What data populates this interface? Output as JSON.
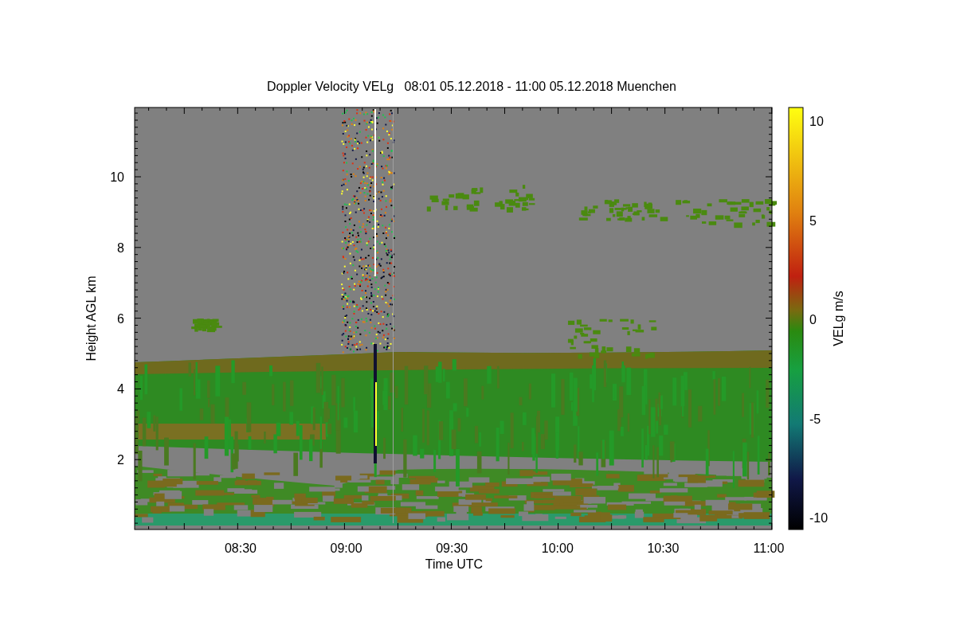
{
  "figure": {
    "title": "Doppler Velocity VELg   08:01 05.12.2018 - 11:00 05.12.2018 Muenchen",
    "plot": {
      "xlabel": "Time UTC",
      "ylabel": "Height AGL km",
      "xticks": [
        "08:30",
        "09:00",
        "09:30",
        "10:00",
        "10:30",
        "11:00"
      ],
      "yticks": [
        "10",
        "8",
        "6",
        "4",
        "2"
      ]
    },
    "colorbar": {
      "label": "VELg m/s",
      "ticks": [
        "10",
        "5",
        "0",
        "-5",
        "-10"
      ]
    }
  }
}
